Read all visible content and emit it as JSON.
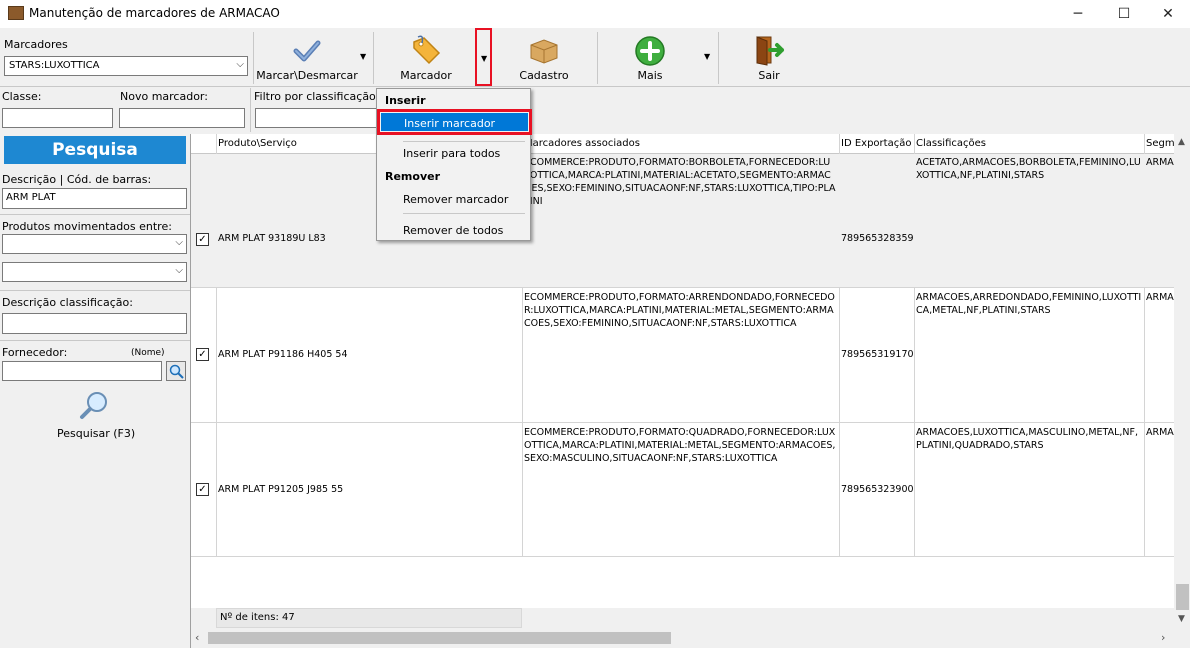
{
  "window": {
    "title": "Manutenção de marcadores de ARMACAO",
    "minimize": "─",
    "maximize": "☐",
    "close": "✕"
  },
  "toolbar": {
    "marcadores_label": "Marcadores",
    "marcadores_value": "STARS:LUXOTTICA",
    "buttons": {
      "marcar": "Marcar\\Desmarcar",
      "marcador": "Marcador",
      "cadastro": "Cadastro",
      "mais": "Mais",
      "sair": "Sair"
    }
  },
  "filters": {
    "classe_label": "Classe:",
    "novo_marcador_label": "Novo marcador:",
    "filtro_label": "Filtro por classificação"
  },
  "sidebar": {
    "pesquisa_title": "Pesquisa",
    "descricao_label": "Descrição | Cód. de barras:",
    "descricao_value": "ARM PLAT",
    "movimentados_label": "Produtos movimentados entre:",
    "desc_class_label": "Descrição classificação:",
    "fornecedor_label": "Fornecedor:",
    "nome_label": "(Nome)",
    "pesquisar_label": "Pesquisar (F3)"
  },
  "grid": {
    "columns": [
      "Produto\\Serviço",
      "Marcadores associados",
      "ID Exportação",
      "Classificações",
      "Segm"
    ],
    "rows": [
      {
        "checked": true,
        "produto": "ARM PLAT 93189U L83",
        "marcadores": "ECOMMERCE:PRODUTO,FORMATO:BORBOLETA,FORNECEDOR:LUXOTTICA,MARCA:PLATINI,MATERIAL:ACETATO,SEGMENTO:ARMACOES,SEXO:FEMININO,SITUACAONF:NF,STARS:LUXOTTICA,TIPO:PLATINI",
        "id": "789565328359",
        "classificacoes": "ACETATO,ARMACOES,BORBOLETA,FEMININO,LUXOTTICA,NF,PLATINI,STARS",
        "segm": "ARMA"
      },
      {
        "checked": true,
        "produto": "ARM PLAT P91186 H405 54",
        "marcadores": "ECOMMERCE:PRODUTO,FORMATO:ARRENDONDADO,FORNECEDOR:LUXOTTICA,MARCA:PLATINI,MATERIAL:METAL,SEGMENTO:ARMACOES,SEXO:FEMININO,SITUACAONF:NF,STARS:LUXOTTICA",
        "id": "789565319170",
        "classificacoes": "ARMACOES,ARREDONDADO,FEMININO,LUXOTTICA,METAL,NF,PLATINI,STARS",
        "segm": "ARMA"
      },
      {
        "checked": true,
        "produto": "ARM PLAT P91205 J985 55",
        "marcadores": "ECOMMERCE:PRODUTO,FORMATO:QUADRADO,FORNECEDOR:LUXOTTICA,MARCA:PLATINI,MATERIAL:METAL,SEGMENTO:ARMACOES,SEXO:MASCULINO,SITUACAONF:NF,STARS:LUXOTTICA",
        "id": "789565323900",
        "classificacoes": "ARMACOES,LUXOTTICA,MASCULINO,METAL,NF,PLATINI,QUADRADO,STARS",
        "segm": "ARMA"
      }
    ],
    "footer": "Nº de itens: 47"
  },
  "menu": {
    "inserir_header": "Inserir",
    "inserir_marcador": "Inserir marcador",
    "inserir_todos": "Inserir para todos",
    "remover_header": "Remover",
    "remover_marcador": "Remover marcador",
    "remover_todos": "Remover de todos"
  },
  "colors": {
    "accent": "#0078d7",
    "highlight_border": "#e81123",
    "pesquisa_bg": "#1e88d2"
  }
}
